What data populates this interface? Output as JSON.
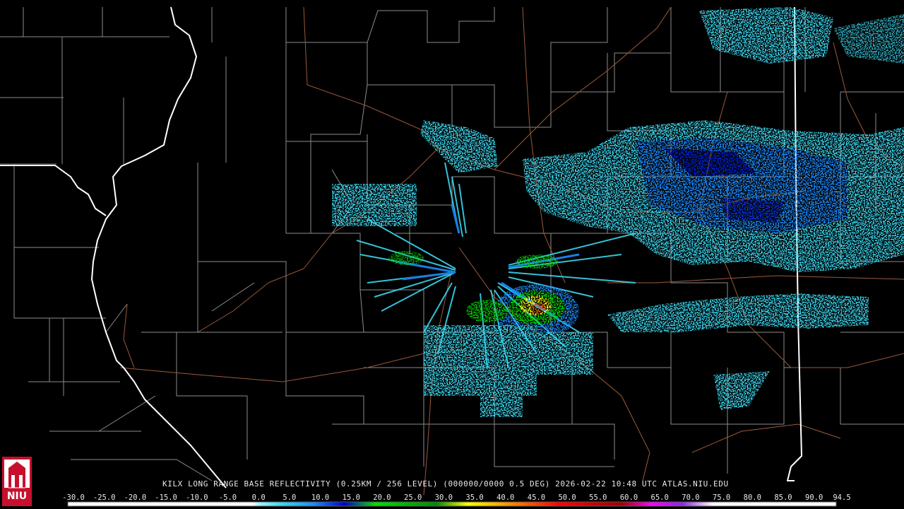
{
  "product_line": "KILX LONG RANGE BASE REFLECTIVITY (0.25KM / 256 LEVEL) (000000/0000 0.5 DEG) 2026-02-22 10:48 UTC  ATLAS.NIU.EDU",
  "logo_text": "NIU",
  "colors": {
    "background": "#000000",
    "county_lines": "#8c8c8c",
    "state_lines": "#ffffff",
    "highways": "#9a5a3a",
    "logo_red": "#c8102e"
  },
  "scale": {
    "labels": [
      "-30.0",
      "-25.0",
      "-20.0",
      "-15.0",
      "-10.0",
      "-5.0",
      "0.0",
      "5.0",
      "10.0",
      "15.0",
      "20.0",
      "25.0",
      "30.0",
      "35.0",
      "40.0",
      "45.0",
      "50.0",
      "55.0",
      "60.0",
      "65.0",
      "70.0",
      "75.0",
      "80.0",
      "85.0",
      "90.0",
      "94.5"
    ],
    "min": -30.0,
    "max": 94.5,
    "stops": [
      {
        "dbz": -30,
        "color": "#ffffff"
      },
      {
        "dbz": 0,
        "color": "#ffffff"
      },
      {
        "dbz": 0,
        "color": "#9ff5ff"
      },
      {
        "dbz": 5,
        "color": "#3ad7f0"
      },
      {
        "dbz": 10,
        "color": "#1a8cff"
      },
      {
        "dbz": 15,
        "color": "#0000cc"
      },
      {
        "dbz": 20,
        "color": "#00e000"
      },
      {
        "dbz": 30,
        "color": "#008a00"
      },
      {
        "dbz": 35,
        "color": "#ffff00"
      },
      {
        "dbz": 40,
        "color": "#ffb000"
      },
      {
        "dbz": 50,
        "color": "#ff0000"
      },
      {
        "dbz": 60,
        "color": "#a00000"
      },
      {
        "dbz": 65,
        "color": "#ff00ff"
      },
      {
        "dbz": 70,
        "color": "#8a2be2"
      },
      {
        "dbz": 75,
        "color": "#ffffff"
      },
      {
        "dbz": 94.5,
        "color": "#ffffff"
      }
    ]
  }
}
